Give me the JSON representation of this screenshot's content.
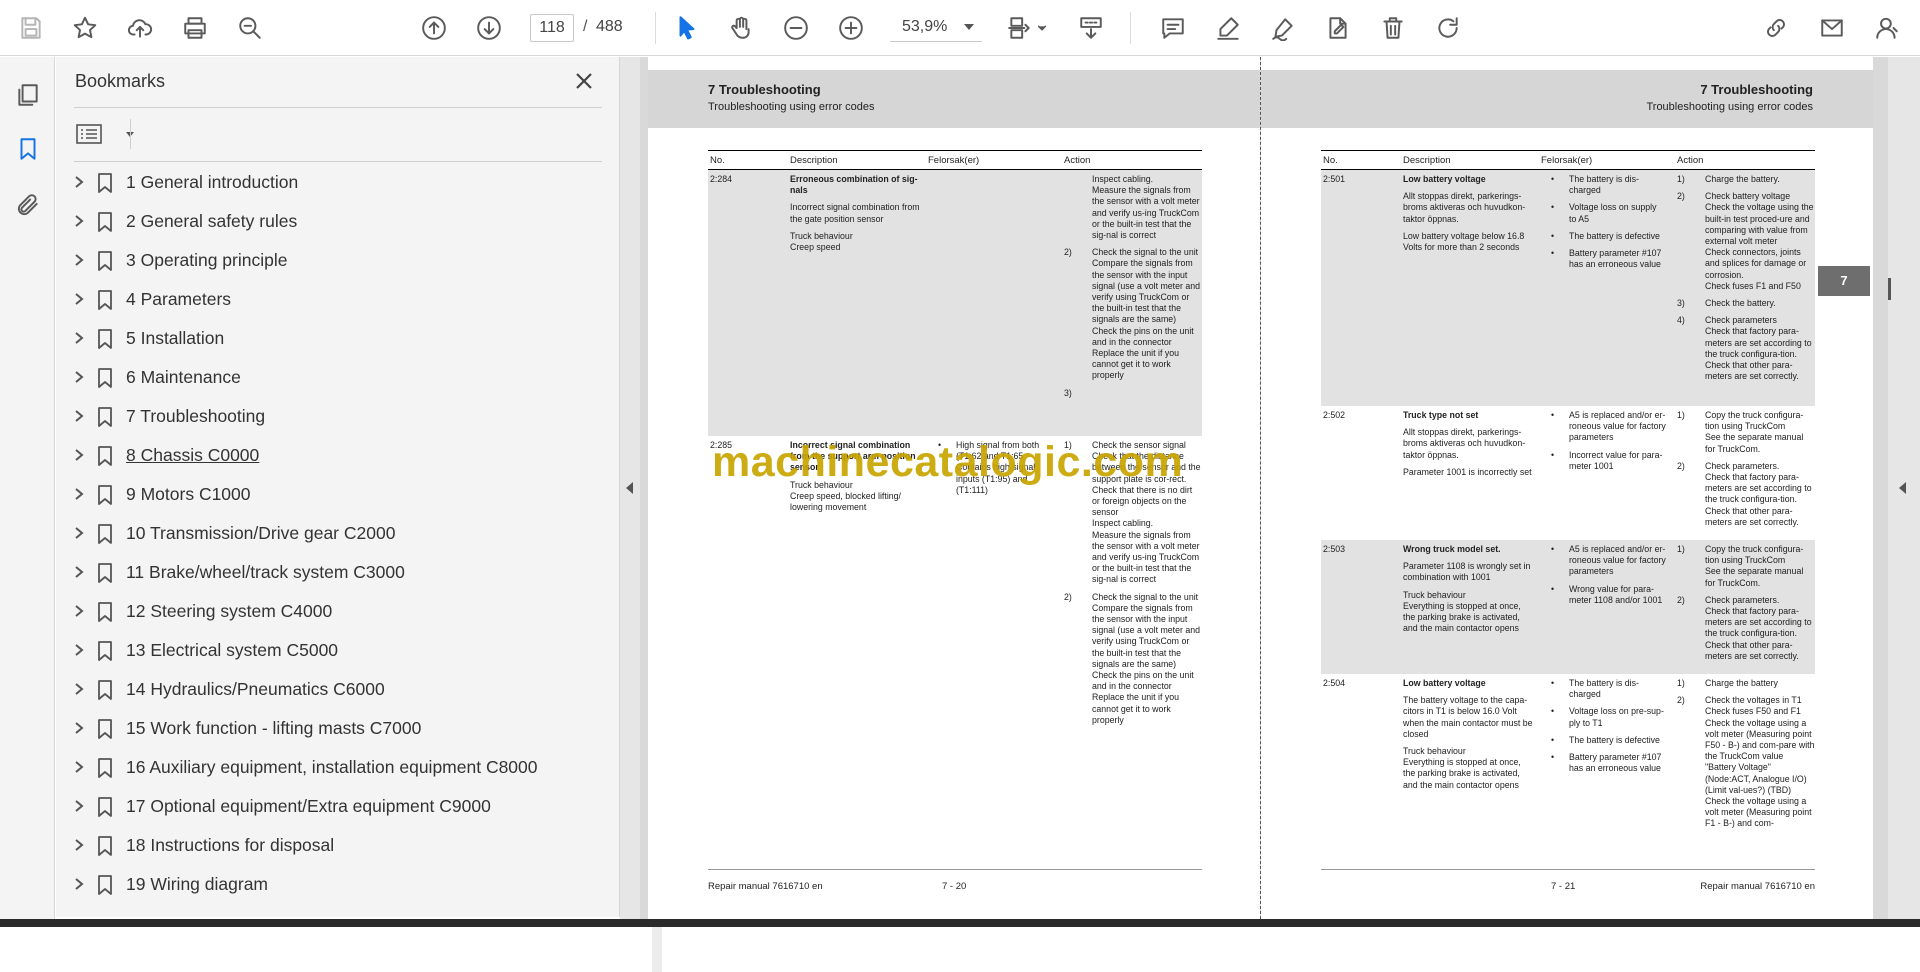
{
  "toolbar": {
    "current_page": "118",
    "page_separator": "/",
    "total_pages": "488",
    "zoom": "53,9%"
  },
  "bookmarks": {
    "title": "Bookmarks",
    "items": [
      {
        "label": "1 General introduction"
      },
      {
        "label": "2 General safety rules"
      },
      {
        "label": "3 Operating principle"
      },
      {
        "label": "4 Parameters"
      },
      {
        "label": "5 Installation"
      },
      {
        "label": "6 Maintenance"
      },
      {
        "label": "7 Troubleshooting"
      },
      {
        "label": "8 Chassis C0000"
      },
      {
        "label": "9 Motors C1000"
      },
      {
        "label": "10 Transmission/Drive gear C2000"
      },
      {
        "label": "11 Brake/wheel/track system C3000"
      },
      {
        "label": "12 Steering system C4000"
      },
      {
        "label": "13 Electrical system C5000"
      },
      {
        "label": "14 Hydraulics/Pneumatics C6000"
      },
      {
        "label": "15 Work function - lifting masts C7000"
      },
      {
        "label": "16 Auxiliary equipment, installation equipment C8000"
      },
      {
        "label": "17 Optional equipment/Extra equipment C9000"
      },
      {
        "label": "18 Instructions for disposal"
      },
      {
        "label": "19 Wiring diagram"
      }
    ]
  },
  "document": {
    "watermark": "machinecatalogic.com",
    "chapter_tab": "7",
    "left_page": {
      "chapter": "7 Troubleshooting",
      "subtitle": "Troubleshooting using error codes",
      "headers": {
        "no": "No.",
        "description": "Description",
        "felorsak": "Felorsak(er)",
        "action": "Action"
      },
      "rows": [
        {
          "no": "2:284",
          "desc_title": "Erroneous combination of sig-nals",
          "desc": [
            "Incorrect signal combination from the gate position sensor",
            "Truck behaviour\nCreep speed"
          ],
          "felorsak": [],
          "actions": [
            {
              "n": "",
              "t": "Inspect cabling.\nMeasure the signals from the sensor with a volt meter and verify us-ing TruckCom or the built-in test that the sig-nal is correct"
            },
            {
              "n": "2)",
              "t": "Check the signal to the unit\nCompare the signals from the sensor with the input signal (use a volt meter and verify using TruckCom or the built-in test that the signals are the same)\nCheck the pins on the unit and in the connector\nReplace the unit if you cannot get it to work properly"
            },
            {
              "n": "3)",
              "t": ""
            }
          ]
        },
        {
          "no": "2:285",
          "desc_title": "Incorrect signal combination from the support arm position sensor",
          "desc": [
            "Truck behaviour\nCreep speed, blocked lifting/ lowering movement"
          ],
          "felorsak": [
            "High signal from both (T1:62 and T1:65 Contains high signal inputs (T1:95) and (T1:111)"
          ],
          "actions": [
            {
              "n": "1)",
              "t": "Check the sensor signal\nCheck that the distance between the sensor and the support plate is cor-rect.\nCheck that there is no dirt or foreign objects on the sensor\nInspect cabling.\nMeasure the signals from the sensor with a volt meter and verify us-ing TruckCom or the built-in test that the sig-nal is correct"
            },
            {
              "n": "2)",
              "t": "Check the signal to the unit\nCompare the signals from the sensor with the input signal (use a volt meter and verify using TruckCom or the built-in test that the signals are the same)\nCheck the pins on the unit and in the connector\nReplace the unit if you cannot get it to work properly"
            }
          ]
        }
      ],
      "footer_left": "Repair manual 7616710 en",
      "footer_page": "7 - 20"
    },
    "right_page": {
      "chapter": "7 Troubleshooting",
      "subtitle": "Troubleshooting using error codes",
      "headers": {
        "no": "No.",
        "description": "Description",
        "felorsak": "Felorsak(er)",
        "action": "Action"
      },
      "rows": [
        {
          "no": "2:501",
          "desc_title": "Low battery voltage",
          "desc": [
            "Allt stoppas direkt, parkerings-broms aktiveras och huvudkon-taktor öppnas.",
            "Low battery voltage below 16.8 Volts for more than 2 seconds"
          ],
          "felorsak": [
            "The battery is dis-charged",
            "Voltage loss on supply to A5",
            "The battery is defective",
            "Battery parameter #107 has an erroneous value"
          ],
          "actions": [
            {
              "n": "1)",
              "t": "Charge the battery."
            },
            {
              "n": "2)",
              "t": "Check battery voltage\nCheck the voltage using the built-in test proced-ure and comparing with value from external volt meter\nCheck connectors, joints and splices for damage or corrosion.\nCheck fuses F1 and F50"
            },
            {
              "n": "3)",
              "t": "Check the battery."
            },
            {
              "n": "4)",
              "t": "Check parameters\nCheck that factory para-meters are set according to the truck configura-tion.\nCheck that other para-meters are set correctly."
            }
          ]
        },
        {
          "no": "2:502",
          "desc_title": "Truck type not set",
          "desc": [
            "Allt stoppas direkt, parkerings-broms aktiveras och huvudkon-taktor öppnas.",
            "Parameter 1001 is incorrectly set"
          ],
          "felorsak": [
            "A5 is replaced and/or er-roneous value for factory parameters",
            "Incorrect value for para-meter 1001"
          ],
          "actions": [
            {
              "n": "1)",
              "t": "Copy the truck configura-tion using TruckCom\nSee the separate manual for TruckCom."
            },
            {
              "n": "2)",
              "t": "Check parameters.\nCheck that factory para-meters are set according to the truck configura-tion.\nCheck that other para-meters are set correctly."
            }
          ]
        },
        {
          "no": "2:503",
          "desc_title": "Wrong truck model set.",
          "desc": [
            "Parameter 1108 is wrongly set in combination with 1001",
            "Truck behaviour\nEverything is stopped at once, the parking brake is activated, and the main contactor opens"
          ],
          "felorsak": [
            "A5 is replaced and/or er-roneous value for factory parameters",
            "Wrong value for para-meter 1108 and/or 1001"
          ],
          "actions": [
            {
              "n": "1)",
              "t": "Copy the truck configura-tion using TruckCom\nSee the separate manual for TruckCom."
            },
            {
              "n": "2)",
              "t": "Check parameters.\nCheck that factory para-meters are set according to the truck configura-tion.\nCheck that other para-meters are set correctly."
            }
          ]
        },
        {
          "no": "2:504",
          "desc_title": "Low battery voltage",
          "desc": [
            "The battery voltage to the capa-citors in T1 is below 16.0 Volt when the main contactor must be closed",
            "Truck behaviour\nEverything is stopped at once, the parking brake is activated, and the main contactor opens"
          ],
          "felorsak": [
            "The battery is dis-charged",
            "Voltage loss on pre-sup-ply to T1",
            "The battery is defective",
            "Battery parameter #107 has an erroneous value"
          ],
          "actions": [
            {
              "n": "1)",
              "t": "Charge the battery"
            },
            {
              "n": "2)",
              "t": "Check the voltages in T1\nCheck fuses F50 and F1\nCheck the voltage using a volt meter (Measuring point F50 - B-) and com-pare with the TruckCom value \"Battery Voltage\" (Node:ACT, Analogue I/O) (Limit val-ues?) (TBD)\nCheck the voltage using a volt meter (Measuring point F1 - B-) and com-"
            }
          ]
        }
      ],
      "footer_page": "7 - 21",
      "footer_right": "Repair manual 7616710 en"
    }
  }
}
